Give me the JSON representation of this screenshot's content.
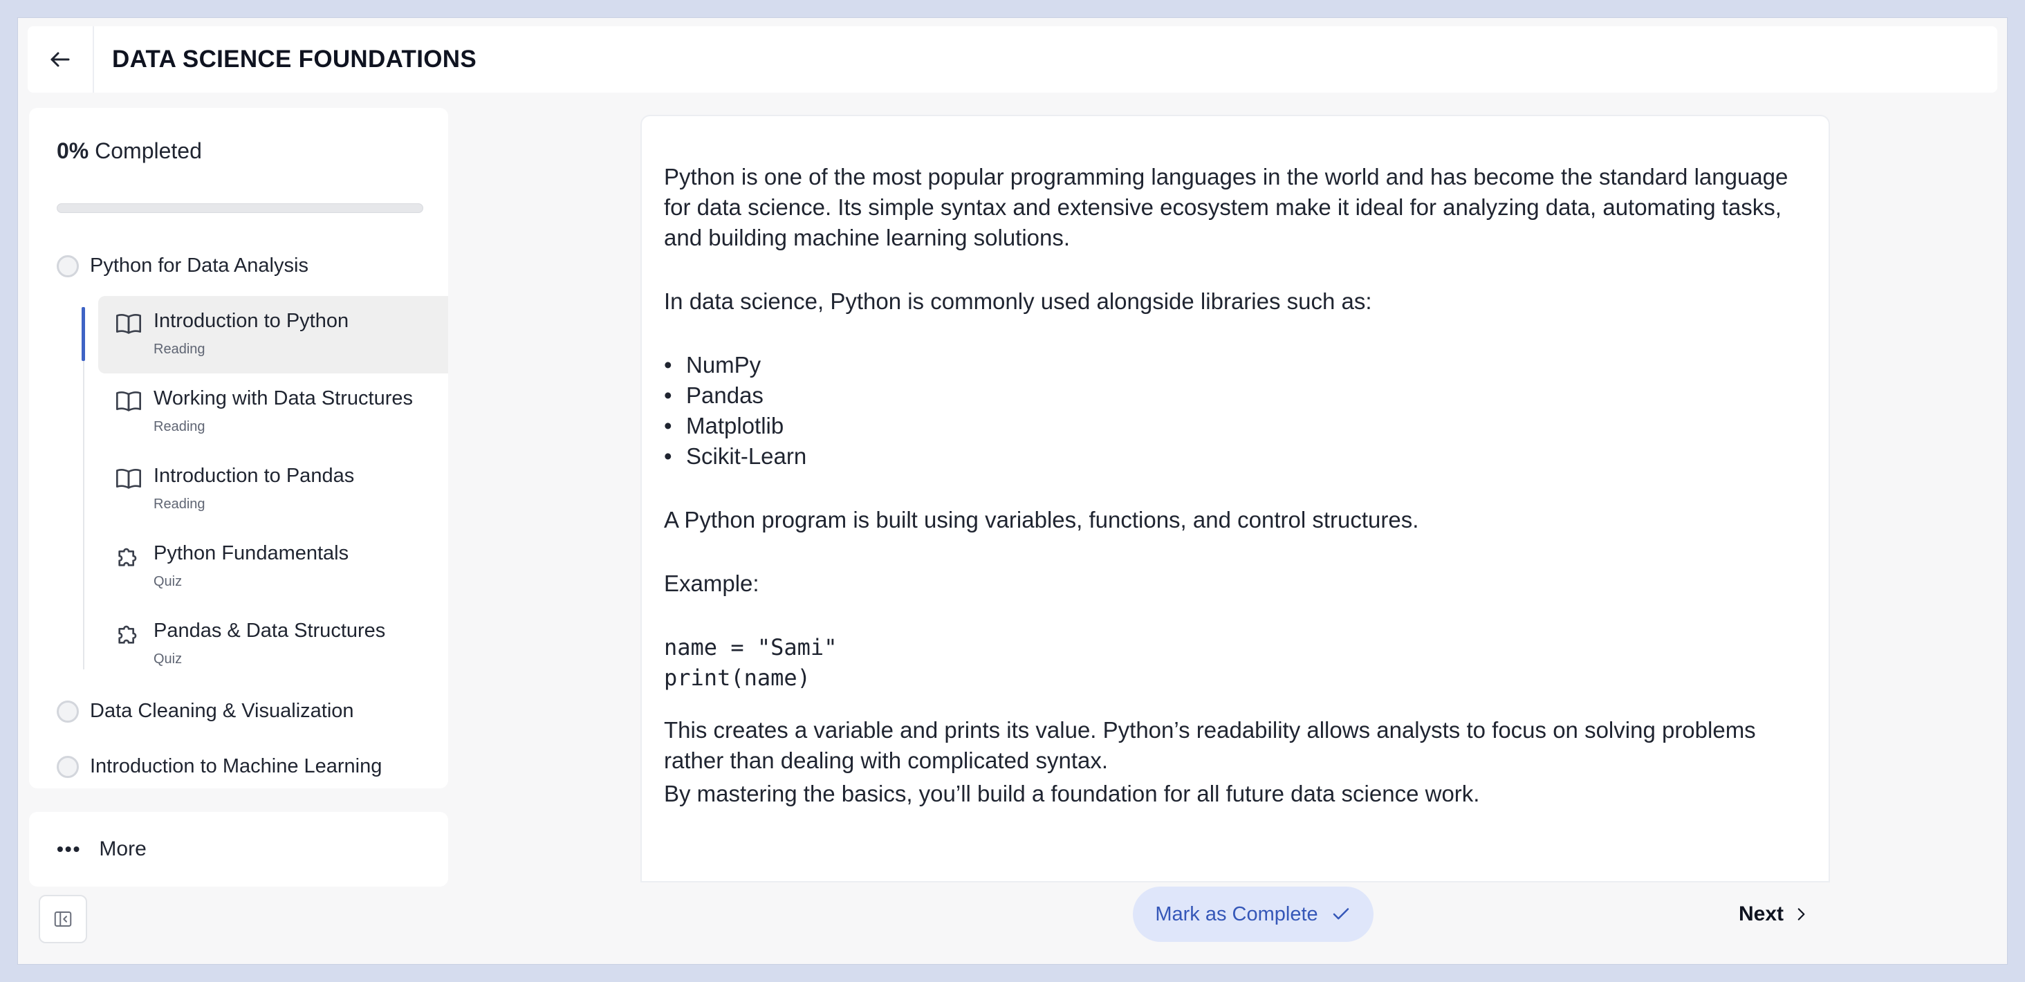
{
  "header": {
    "title": "DATA SCIENCE FOUNDATIONS",
    "back_icon": "arrow-left-icon"
  },
  "sidebar": {
    "progress": {
      "percent_text": "0%",
      "suffix": "Completed",
      "value": 0
    },
    "modules": [
      {
        "label": "Python for Data Analysis",
        "status": "not-started"
      },
      {
        "label": "Data Cleaning & Visualization",
        "status": "not-started"
      },
      {
        "label": "Introduction to Machine Learning",
        "status": "not-started"
      }
    ],
    "lessons": [
      {
        "title": "Introduction to Python",
        "type": "Reading",
        "icon": "book-open-icon",
        "active": true
      },
      {
        "title": "Working with Data Structures",
        "type": "Reading",
        "icon": "book-open-icon",
        "active": false
      },
      {
        "title": "Introduction to Pandas",
        "type": "Reading",
        "icon": "book-open-icon",
        "active": false
      },
      {
        "title": "Python Fundamentals",
        "type": "Quiz",
        "icon": "puzzle-icon",
        "active": false
      },
      {
        "title": "Pandas & Data Structures",
        "type": "Quiz",
        "icon": "puzzle-icon",
        "active": false
      }
    ],
    "more_label": "More",
    "collapse_icon": "sidebar-collapse-icon"
  },
  "content": {
    "intro": "Python is one of the most popular programming languages in the world and has become the standard language for data science. Its simple syntax and extensive ecosystem make it ideal for analyzing data, automating tasks, and building machine learning solutions.",
    "libraries_intro": "In data science, Python is commonly used alongside libraries such as:",
    "libraries": [
      "NumPy",
      "Pandas",
      "Matplotlib",
      "Scikit-Learn"
    ],
    "structure": "A Python program is built using variables, functions, and control structures.",
    "example_label": "Example:",
    "code_lines": [
      "name = \"Sami\"",
      "print(name)"
    ],
    "explanation": "This creates a variable and prints its value. Python’s readability allows analysts to focus on solving problems rather than dealing with complicated syntax.",
    "conclusion": "By mastering the basics, you’ll build a foundation for all future data science work."
  },
  "footer": {
    "complete_label": "Mark as Complete",
    "next_label": "Next"
  },
  "colors": {
    "accent": "#3e63c5",
    "complete_bg": "#dfe6fa",
    "page_bg": "#d5dcee"
  }
}
